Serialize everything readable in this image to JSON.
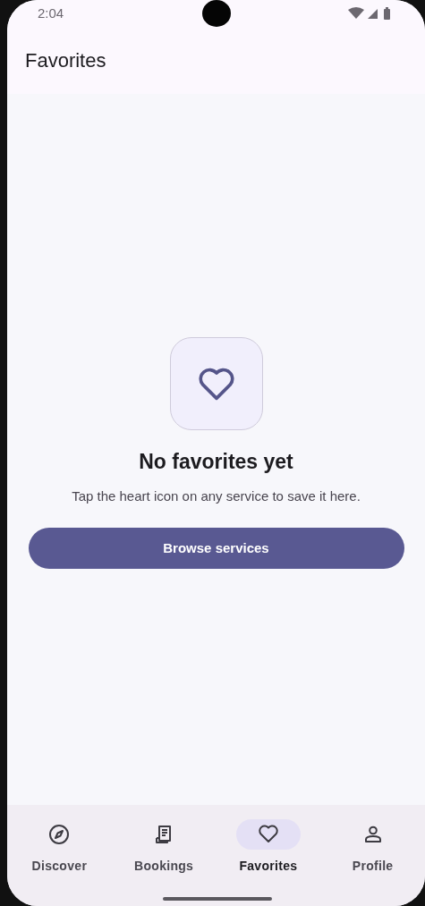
{
  "status_bar": {
    "time": "2:04"
  },
  "app_bar": {
    "title": "Favorites"
  },
  "empty_state": {
    "heading": "No favorites yet",
    "message": "Tap the heart icon on any service to save it here.",
    "button": "Browse services"
  },
  "bottom_nav": [
    {
      "label": "Discover",
      "kind": "compass",
      "selected": false
    },
    {
      "label": "Bookings",
      "kind": "receipt",
      "selected": false
    },
    {
      "label": "Favorites",
      "kind": "heart",
      "selected": true
    },
    {
      "label": "Profile",
      "kind": "person",
      "selected": false
    }
  ]
}
